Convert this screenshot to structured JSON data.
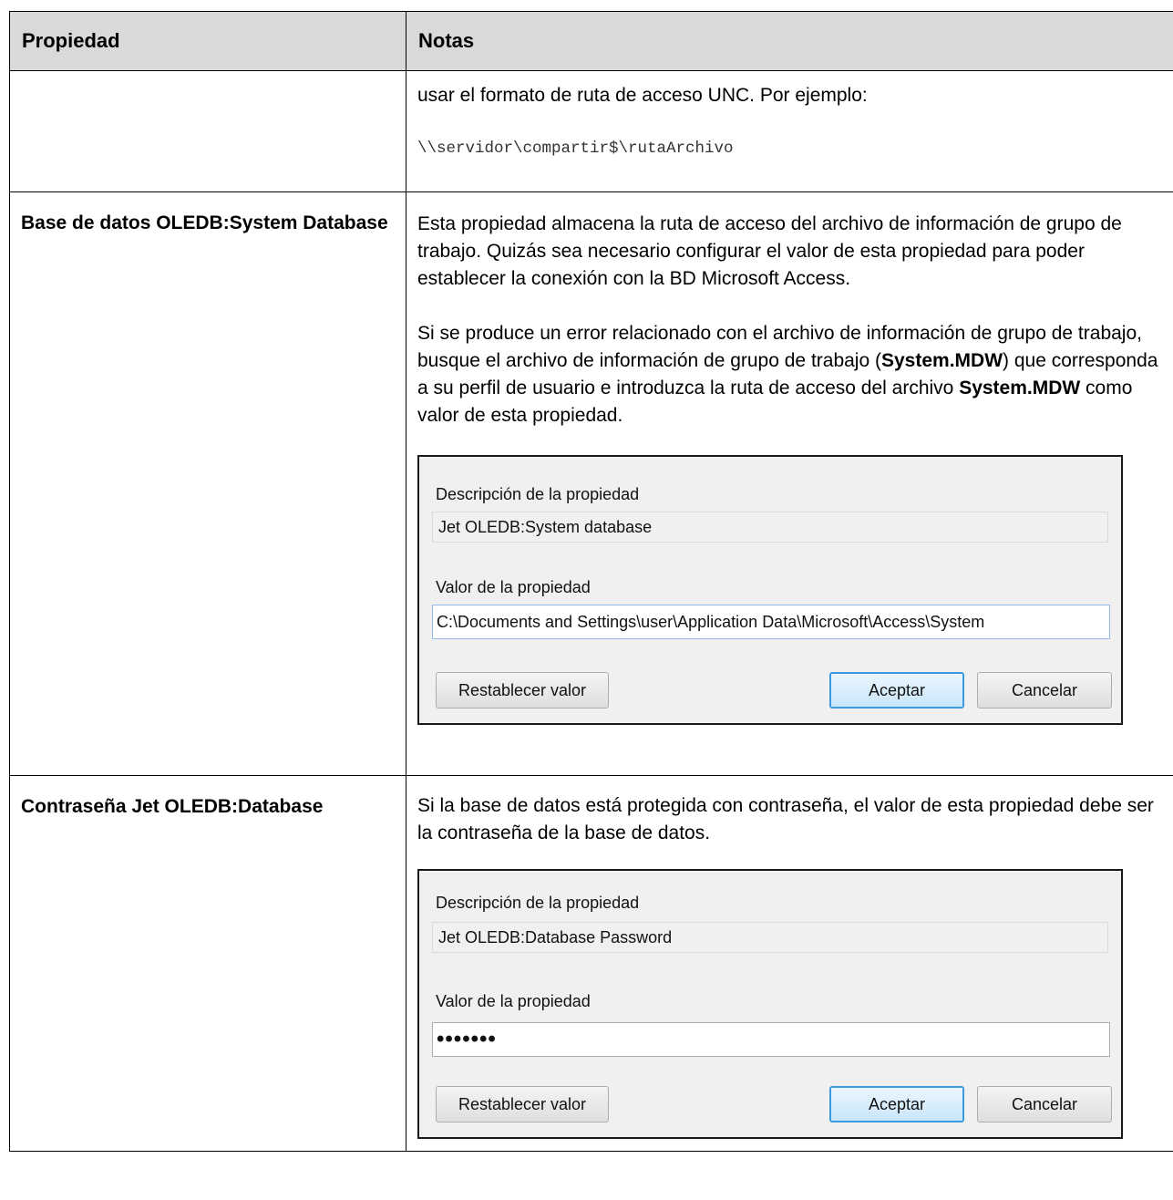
{
  "table": {
    "header": {
      "col1": "Propiedad",
      "col2": "Notas"
    },
    "row1": {
      "property": "",
      "line1": "usar el formato de ruta de acceso UNC. Por ejemplo:",
      "example": "\\\\servidor\\compartir$\\rutaArchivo"
    },
    "row2": {
      "property": "Base de datos OLEDB:System Database",
      "para1": "Esta propiedad almacena la ruta de acceso del archivo de información de grupo de trabajo. Quizás sea necesario configurar el valor de esta propiedad para poder establecer la conexión con la BD Microsoft Access.",
      "para2_pre": "Si se produce un error relacionado con el archivo de información de grupo de trabajo, busque el archivo de información de grupo de trabajo (",
      "para2_bold1": "System.MDW",
      "para2_mid": ") que corresponda a su perfil de usuario e introduzca la ruta de acceso del archivo ",
      "para2_bold2": "System.MDW",
      "para2_post": " como valor de esta propiedad.",
      "dialog": {
        "desc_label": "Descripción de la propiedad",
        "desc_value": "Jet OLEDB:System database",
        "value_label": "Valor de la propiedad",
        "value": "C:\\Documents and Settings\\user\\Application Data\\Microsoft\\Access\\System",
        "reset_button": "Restablecer valor",
        "ok_button": "Aceptar",
        "cancel_button": "Cancelar"
      }
    },
    "row3": {
      "property": "Contraseña Jet OLEDB:Database",
      "para1": "Si la base de datos está protegida con contraseña, el valor de esta propiedad debe ser la contraseña de la base de datos.",
      "dialog": {
        "desc_label": "Descripción de la propiedad",
        "desc_value": "Jet OLEDB:Database Password",
        "value_label": "Valor de la propiedad",
        "value": "•••••••",
        "reset_button": "Restablecer valor",
        "ok_button": "Aceptar",
        "cancel_button": "Cancelar"
      }
    }
  }
}
